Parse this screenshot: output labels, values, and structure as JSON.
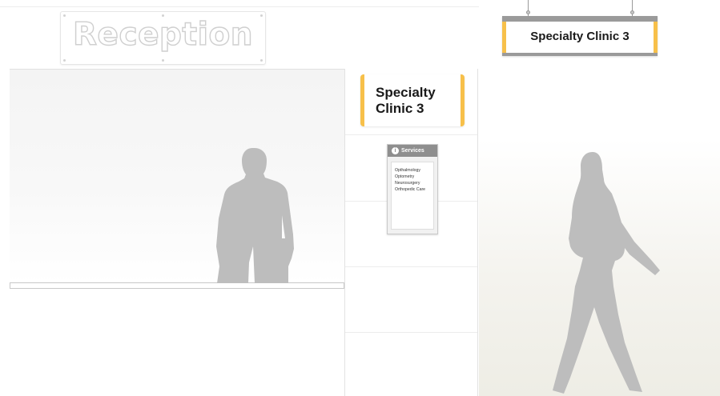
{
  "reception_sign": {
    "text": "Reception"
  },
  "wall_sign": {
    "line1": "Specialty",
    "line2": "Clinic 3"
  },
  "hanging_sign": {
    "text": "Specialty Clinic 3"
  },
  "services_directory": {
    "title": "Services",
    "icon": "info-icon",
    "items": [
      "Opthalmology",
      "Optometry",
      "Neurosurgery",
      "Orthopedic Care"
    ]
  },
  "colors": {
    "sign_accent": "#f7c04a",
    "sign_frame": "#9a9a9a",
    "silhouette": "#bdbdbd",
    "reception_outline": "#cfcfcf"
  }
}
